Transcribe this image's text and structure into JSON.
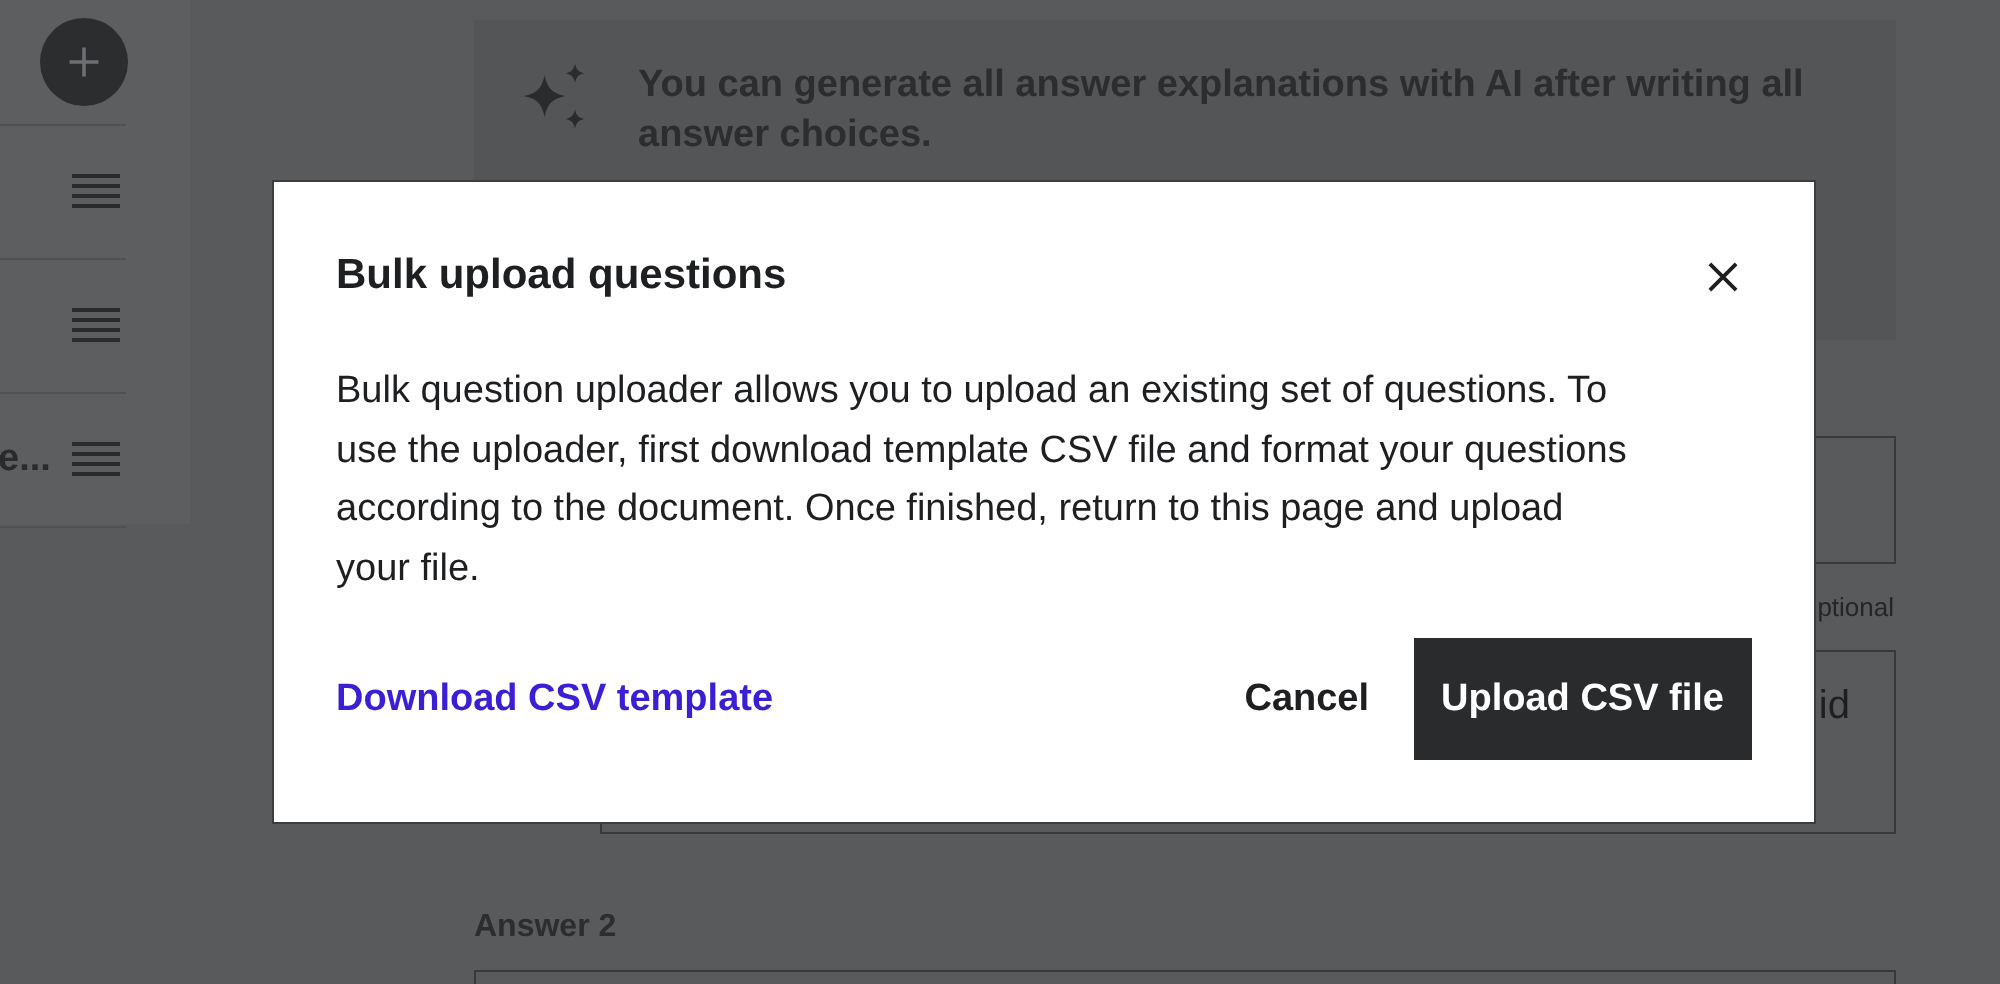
{
  "sidebar": {
    "items": [
      {
        "kind": "handle"
      },
      {
        "kind": "handle"
      },
      {
        "kind": "labeled",
        "label": "e..."
      }
    ]
  },
  "banner": {
    "text": "You can generate all answer explanations with AI after writing all answer choices."
  },
  "form": [
    {
      "kind": "box"
    },
    {
      "kind": "note",
      "text": "ptional"
    },
    {
      "kind": "box",
      "text": "id"
    },
    {
      "kind": "heading",
      "text": "Answer 2"
    },
    {
      "kind": "box"
    }
  ],
  "dialog": {
    "title": "Bulk upload questions",
    "body": "Bulk question uploader allows you to upload an existing set of questions. To use the uploader, first download template CSV file and format your questions according to the document. Once finished, return to this page and upload your file.",
    "link": "Download CSV template",
    "buttons": [
      {
        "kind": "plain",
        "label": "Cancel"
      },
      {
        "kind": "primary",
        "label": "Upload CSV file"
      }
    ]
  }
}
